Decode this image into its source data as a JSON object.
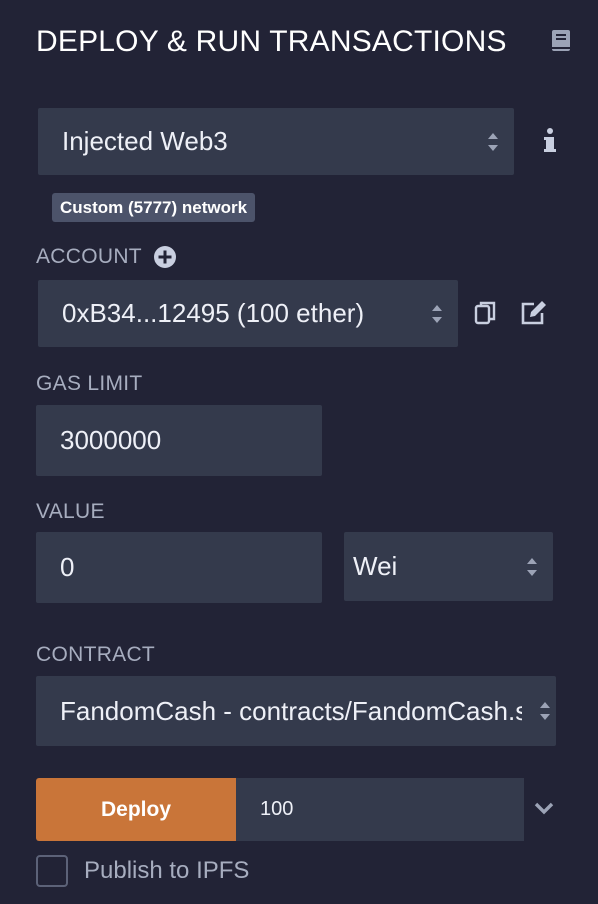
{
  "header": {
    "title": "DEPLOY & RUN TRANSACTIONS",
    "docs_icon": "book-icon"
  },
  "environment": {
    "selected": "Injected Web3",
    "info_icon": "info-icon"
  },
  "network_badge": "Custom (5777) network",
  "account": {
    "label": "ACCOUNT",
    "add_icon": "plus-circle-icon",
    "selected": "0xB34...12495 (100 ether)",
    "copy_icon": "copy-icon",
    "edit_icon": "edit-icon"
  },
  "gas_limit": {
    "label": "GAS LIMIT",
    "value": "3000000"
  },
  "value": {
    "label": "VALUE",
    "amount": "0",
    "unit": "Wei"
  },
  "contract": {
    "label": "CONTRACT",
    "selected": "FandomCash - contracts/FandomCash.sol"
  },
  "deploy": {
    "button_label": "Deploy",
    "args_value": "100",
    "expand_icon": "chevron-down-icon"
  },
  "publish": {
    "label": "Publish to IPFS",
    "checked": false
  },
  "colors": {
    "background": "#222336",
    "field": "#343a4c",
    "deploy": "#c97539",
    "badge": "#4c536a"
  }
}
